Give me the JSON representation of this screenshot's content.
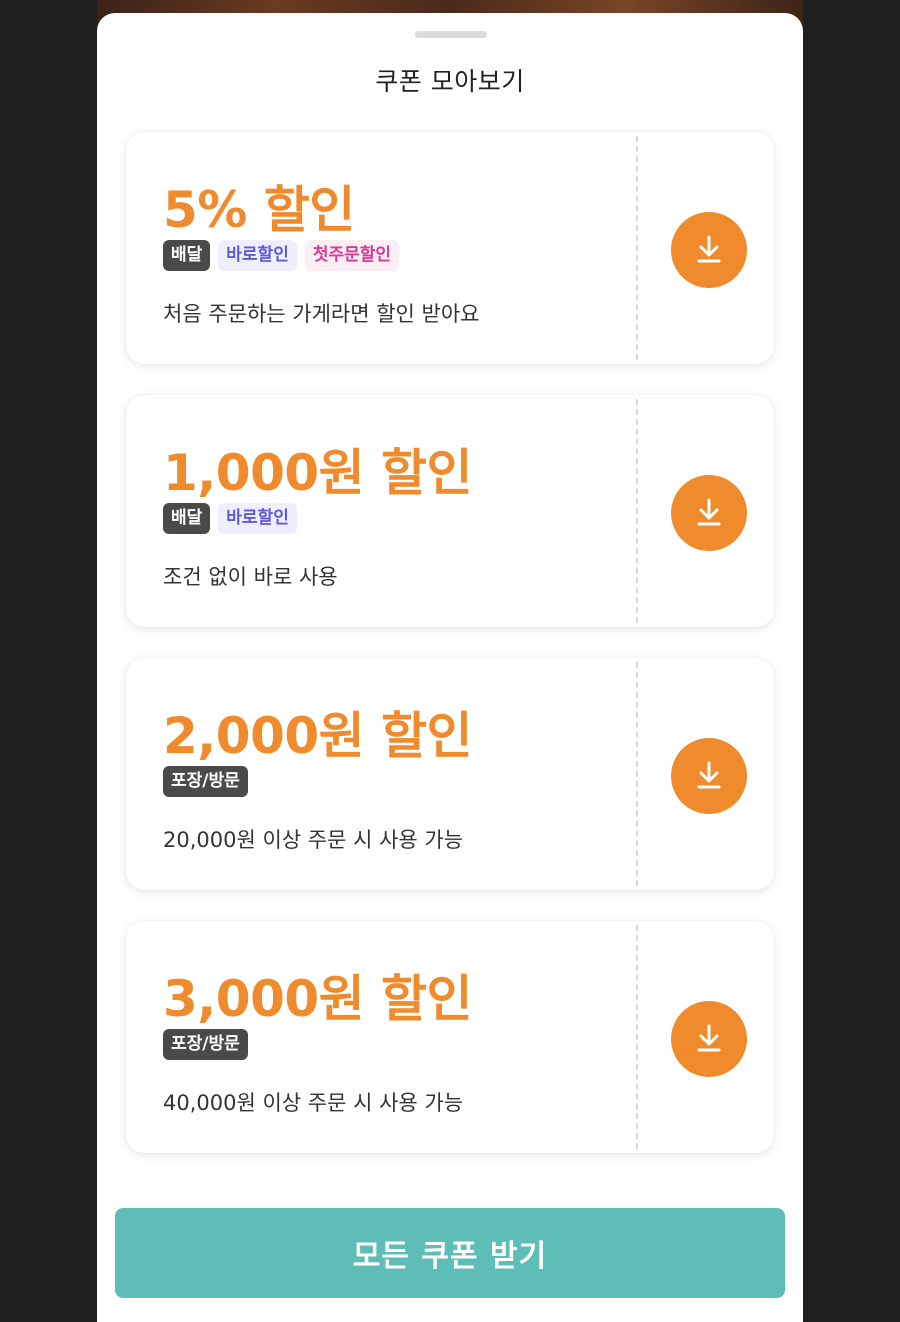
{
  "sheet": {
    "title": "쿠폰 모아보기"
  },
  "coupons": [
    {
      "title": "5% 할인",
      "tags": [
        {
          "label": "배달",
          "style": "dark"
        },
        {
          "label": "바로할인",
          "style": "blue"
        },
        {
          "label": "첫주문할인",
          "style": "pink"
        }
      ],
      "description": "처음 주문하는 가게라면 할인 받아요",
      "download_icon": "download-icon"
    },
    {
      "title": "1,000원 할인",
      "tags": [
        {
          "label": "배달",
          "style": "dark"
        },
        {
          "label": "바로할인",
          "style": "blue"
        }
      ],
      "description": "조건 없이 바로 사용",
      "download_icon": "download-icon"
    },
    {
      "title": "2,000원 할인",
      "tags": [
        {
          "label": "포장/방문",
          "style": "dark"
        }
      ],
      "description": "20,000원 이상 주문 시 사용 가능",
      "download_icon": "download-icon"
    },
    {
      "title": "3,000원 할인",
      "tags": [
        {
          "label": "포장/방문",
          "style": "dark"
        }
      ],
      "description": "40,000원 이상 주문 시 사용 가능",
      "download_icon": "download-icon"
    }
  ],
  "footer": {
    "all_coupons_label": "모든 쿠폰 받기"
  },
  "colors": {
    "accent_orange": "#ef8b2c",
    "button_teal": "#5fbdb7",
    "tag_dark": "#4a4a4a",
    "tag_blue_text": "#6158d6",
    "tag_pink_text": "#d63a96"
  }
}
